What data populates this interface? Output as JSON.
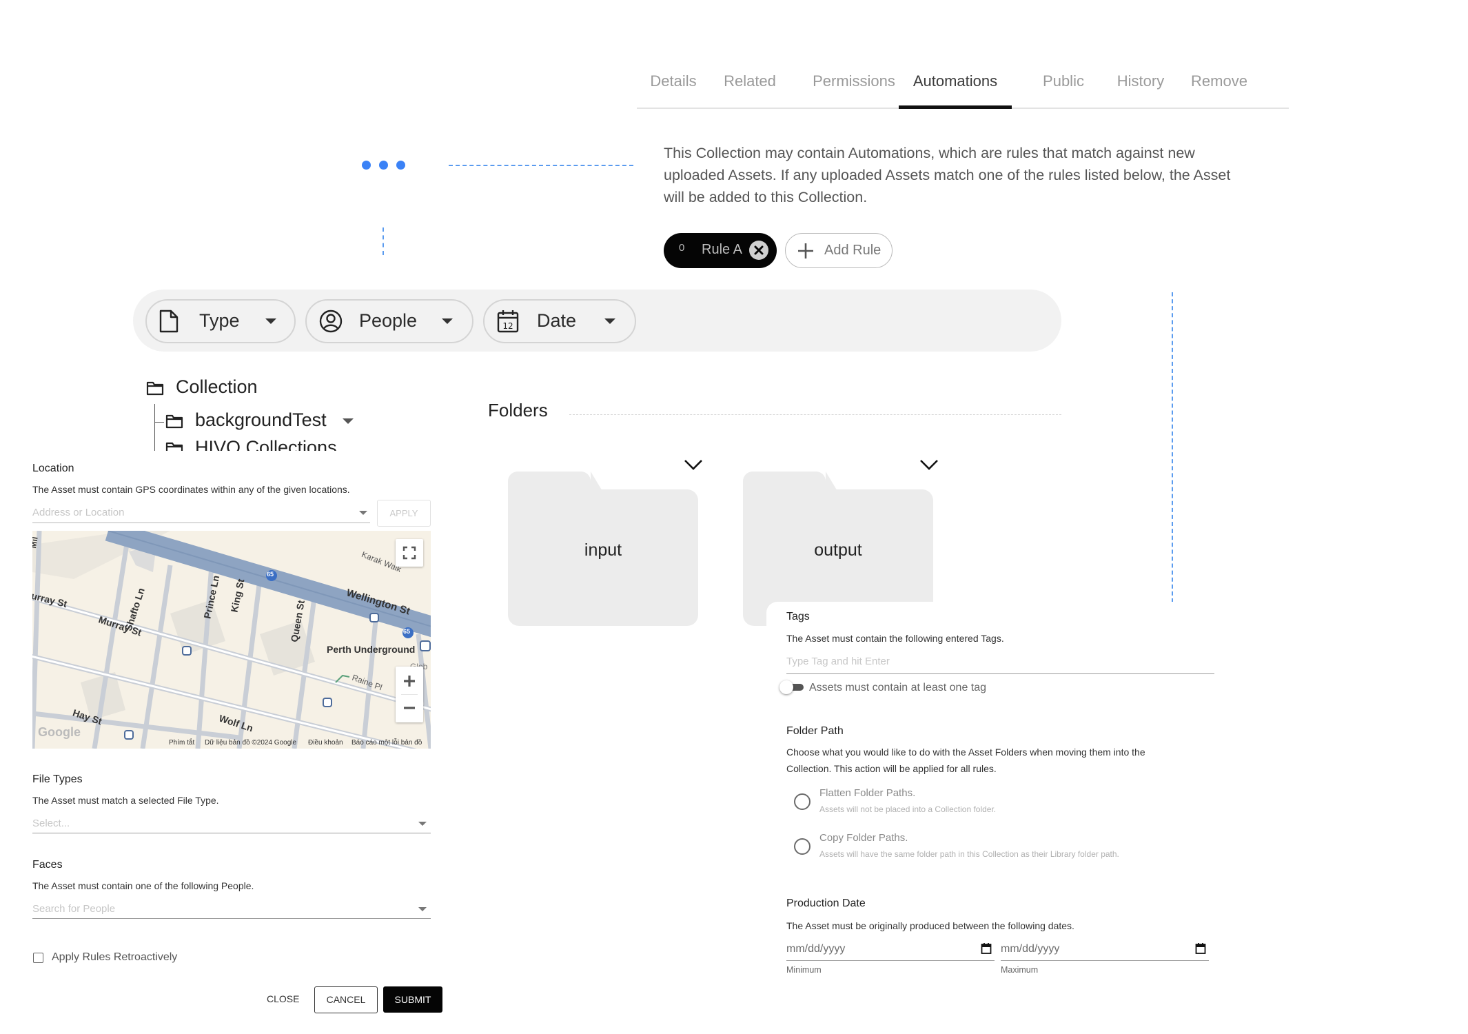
{
  "tabs": [
    "Details",
    "Related",
    "Permissions",
    "Automations",
    "Public",
    "History",
    "Remove"
  ],
  "active_tab": "Automations",
  "description": "This Collection may contain Automations, which are rules that match against new uploaded Assets. If any uploaded Assets match one of the rules listed below, the Asset will be added to this Collection.",
  "rules": {
    "count": "0",
    "rule_label": "Rule A",
    "add_label": "Add Rule"
  },
  "filters": {
    "type": "Type",
    "people": "People",
    "date": "Date",
    "date_icon_num": "12"
  },
  "tree": {
    "root": "Collection",
    "child1": "backgroundTest",
    "child2": "HIVO Collections"
  },
  "folders": {
    "title": "Folders",
    "items": [
      "input",
      "output"
    ]
  },
  "location": {
    "title": "Location",
    "subtitle": "The Asset must contain GPS coordinates within any of the given locations.",
    "placeholder": "Address or Location",
    "apply": "APPLY"
  },
  "map": {
    "labels": {
      "karak_walk": "Karak Walk",
      "wellington": "Wellington St",
      "murray1": "Murray St",
      "murray2": "urray St",
      "shafto": "Shafto Ln",
      "prince": "Prince Ln",
      "king": "King St",
      "queen": "Queen St",
      "perth": "Perth Underground",
      "raine": "Raine Pl",
      "hay": "Hay St",
      "wolf": "Wolf Ln",
      "glob": "Glob",
      "mil": "Mil",
      "route1": "65",
      "route2": "65",
      "logo": "Google"
    },
    "footer": {
      "shortcuts": "Phím tắt",
      "data": "Dữ liệu bản đồ ©2024 Google",
      "terms": "Điều khoản",
      "report": "Báo cáo một lỗi bản đồ"
    }
  },
  "file_types": {
    "title": "File Types",
    "subtitle": "The Asset must match a selected File Type.",
    "placeholder": "Select..."
  },
  "faces": {
    "title": "Faces",
    "subtitle": "The Asset must contain one of the following People.",
    "placeholder": "Search for People"
  },
  "retro": {
    "label": "Apply Rules Retroactively"
  },
  "buttons": {
    "close": "CLOSE",
    "cancel": "CANCEL",
    "submit": "SUBMIT"
  },
  "tags": {
    "title": "Tags",
    "subtitle": "The Asset must contain the following entered Tags.",
    "placeholder": "Type Tag and hit Enter",
    "toggle_label": "Assets must contain at least one tag"
  },
  "folder_path": {
    "title": "Folder Path",
    "subtitle_line1": "Choose what you would like to do with the Asset Folders when moving them into the",
    "subtitle_line2": "Collection. This action will be applied for all rules.",
    "options": [
      {
        "title": "Flatten Folder Paths.",
        "sub": "Assets will not be placed into a Collection folder."
      },
      {
        "title": "Copy Folder Paths.",
        "sub": "Assets will have the same folder path in this Collection as their Library folder path."
      }
    ]
  },
  "production_date": {
    "title": "Production Date",
    "subtitle": "The Asset must be originally produced between the following dates.",
    "min_value": "mm/dd/yyyy",
    "max_value": "mm/dd/yyyy",
    "min_caption": "Minimum",
    "max_caption": "Maximum"
  },
  "colors": {
    "accent_blue": "#3b82f6",
    "black": "#050505",
    "panel_gray": "#f2f2f2",
    "folder_gray": "#ececec"
  },
  "icons": [
    "file-icon",
    "person-circle-icon",
    "calendar-icon",
    "folder-icon",
    "close-circle-icon",
    "plus-icon",
    "chevron-down-icon",
    "fullscreen-icon",
    "zoom-in-icon",
    "zoom-out-icon"
  ]
}
